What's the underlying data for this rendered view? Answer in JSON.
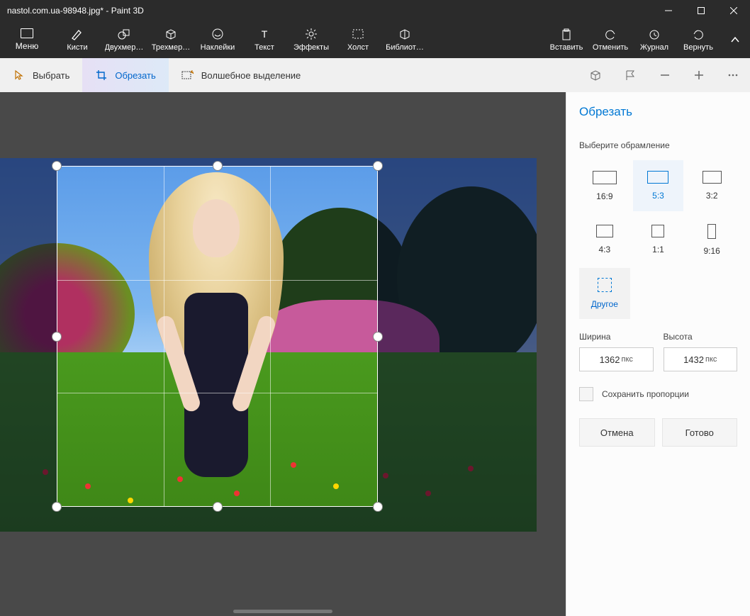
{
  "title": "nastol.com.ua-98948.jpg* - Paint 3D",
  "menu_label": "Меню",
  "ribbon": {
    "brushes": "Кисти",
    "shapes2d": "Двухмер…",
    "shapes3d": "Трехмер…",
    "stickers": "Наклейки",
    "text": "Текст",
    "effects": "Эффекты",
    "canvas": "Холст",
    "library": "Библиот…",
    "paste": "Вставить",
    "undo": "Отменить",
    "history": "Журнал",
    "redo": "Вернуть"
  },
  "subbar": {
    "select": "Выбрать",
    "crop": "Обрезать",
    "magic": "Волшебное выделение"
  },
  "panel": {
    "title": "Обрезать",
    "frame_label": "Выберите обрамление",
    "ratios": {
      "r169": "16:9",
      "r53": "5:3",
      "r32": "3:2",
      "r43": "4:3",
      "r11": "1:1",
      "r916": "9:16",
      "other": "Другое"
    },
    "width_label": "Ширина",
    "height_label": "Высота",
    "width_value": "1362",
    "height_value": "1432",
    "unit": "пкс",
    "lock_ratio": "Сохранить пропорции",
    "cancel": "Отмена",
    "done": "Готово"
  }
}
